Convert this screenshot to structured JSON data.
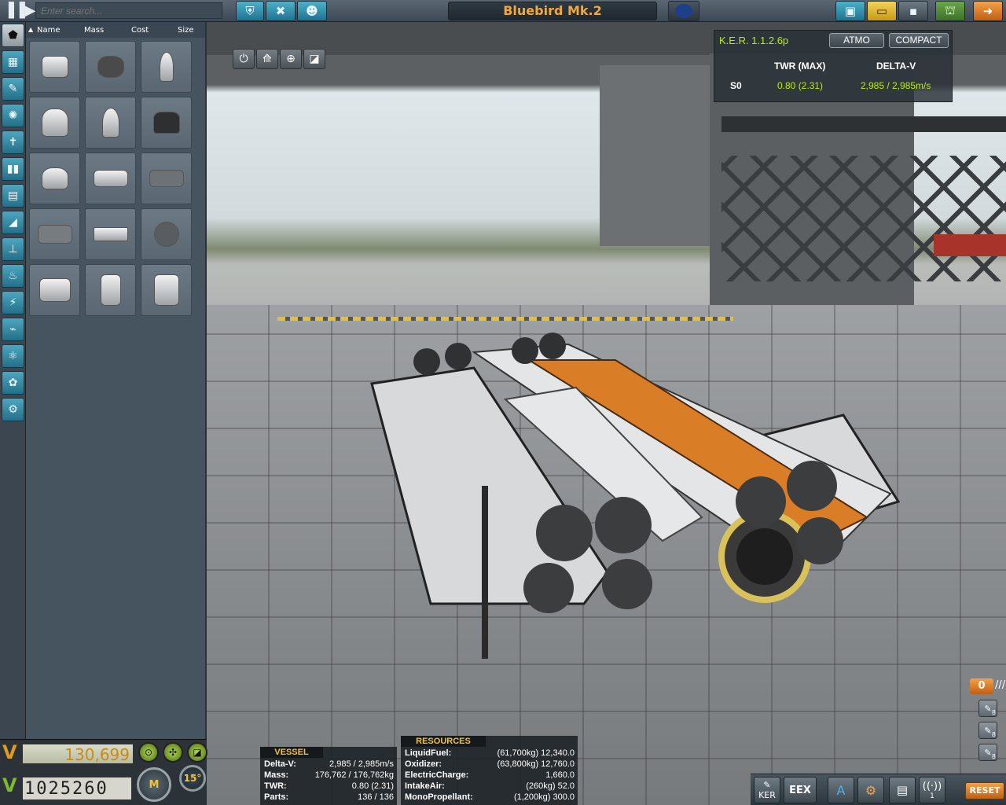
{
  "search": {
    "placeholder": "Enter search..."
  },
  "vessel_name": "Bluebird  Mk.2",
  "parts_header": {
    "name": "Name",
    "mass": "Mass",
    "cost": "Cost",
    "size": "Size"
  },
  "funds": "130,699",
  "science": "1025260",
  "mode_button": "M",
  "angle_snap": "15°",
  "ker": {
    "title": "K.E.R. 1.1.2.6p",
    "atmo": "ATMO",
    "compact": "COMPACT",
    "col_twr": "TWR (MAX)",
    "col_dv": "DELTA-V",
    "stage": "S0",
    "twr": "0.80 (2.31)",
    "dv": "2,985 / 2,985m/s"
  },
  "vessel_info": {
    "title": "VESSEL",
    "rows": [
      {
        "k": "Delta-V:",
        "v": "2,985 / 2,985m/s"
      },
      {
        "k": "Mass:",
        "v": "176,762 / 176,762kg"
      },
      {
        "k": "TWR:",
        "v": "0.80 (2.31)"
      },
      {
        "k": "Parts:",
        "v": "136 / 136"
      }
    ]
  },
  "resources": {
    "title": "RESOURCES",
    "rows": [
      {
        "k": "LiquidFuel:",
        "v": "(61,700kg) 12,340.0"
      },
      {
        "k": "Oxidizer:",
        "v": "(63,800kg) 12,760.0"
      },
      {
        "k": "ElectricCharge:",
        "v": "1,660.0"
      },
      {
        "k": "IntakeAir:",
        "v": "(260kg) 52.0"
      },
      {
        "k": "MonoPropellant:",
        "v": "(1,200kg) 300.0"
      }
    ]
  },
  "staging": {
    "count": "0",
    "badges": [
      "8",
      "8",
      "8"
    ]
  },
  "bottom_bar": {
    "ker": "KER",
    "eex": "EEX",
    "reset": "RESET",
    "signal": "1"
  }
}
